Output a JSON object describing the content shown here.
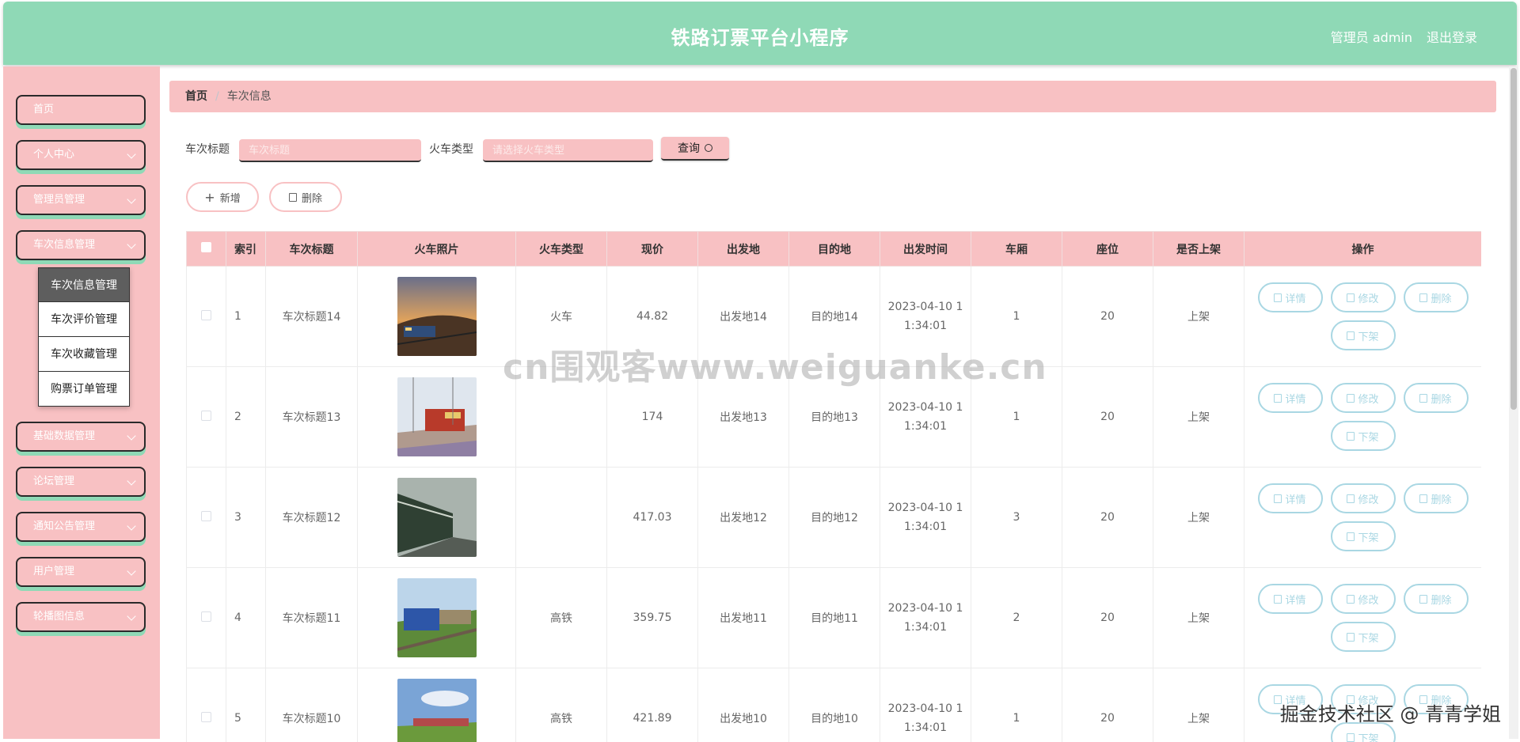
{
  "header": {
    "title": "铁路订票平台小程序",
    "user": "管理员 admin",
    "logout": "退出登录"
  },
  "sidebar": {
    "items": [
      {
        "label": "首页",
        "has_chevron": false
      },
      {
        "label": "个人中心",
        "has_chevron": true
      },
      {
        "label": "管理员管理",
        "has_chevron": true
      },
      {
        "label": "车次信息管理",
        "has_chevron": true
      },
      {
        "label": "基础数据管理",
        "has_chevron": true
      },
      {
        "label": "论坛管理",
        "has_chevron": true
      },
      {
        "label": "通知公告管理",
        "has_chevron": true
      },
      {
        "label": "用户管理",
        "has_chevron": true
      },
      {
        "label": "轮播图信息",
        "has_chevron": true
      }
    ],
    "submenu": [
      {
        "label": "车次信息管理",
        "active": true
      },
      {
        "label": "车次评价管理",
        "active": false
      },
      {
        "label": "车次收藏管理",
        "active": false
      },
      {
        "label": "购票订单管理",
        "active": false
      }
    ]
  },
  "breadcrumb": {
    "home": "首页",
    "current": "车次信息"
  },
  "filters": {
    "title_label": "车次标题",
    "title_placeholder": "车次标题",
    "type_label": "火车类型",
    "type_placeholder": "请选择火车类型",
    "query_label": "查询"
  },
  "actions": {
    "add_label": "新增",
    "delete_label": "删除"
  },
  "table": {
    "columns": [
      "",
      "索引",
      "车次标题",
      "火车照片",
      "火车类型",
      "现价",
      "出发地",
      "目的地",
      "出发时间",
      "车厢",
      "座位",
      "是否上架",
      "操作"
    ],
    "op_labels": {
      "detail": "详情",
      "edit": "修改",
      "delete": "删除",
      "offshelf": "下架"
    },
    "rows": [
      {
        "index": "1",
        "title": "车次标题14",
        "photo": "sunset-train",
        "type": "火车",
        "price": "44.82",
        "from": "出发地14",
        "to": "目的地14",
        "time": "2023-04-10 1\n1:34:01",
        "carriage": "1",
        "seats": "20",
        "listed": "上架"
      },
      {
        "index": "2",
        "title": "车次标题13",
        "photo": "red-locomotive",
        "type": "",
        "price": "174",
        "from": "出发地13",
        "to": "目的地13",
        "time": "2023-04-10 1\n1:34:01",
        "carriage": "1",
        "seats": "20",
        "listed": "上架"
      },
      {
        "index": "3",
        "title": "车次标题12",
        "photo": "green-train",
        "type": "",
        "price": "417.03",
        "from": "出发地12",
        "to": "目的地12",
        "time": "2023-04-10 1\n1:34:01",
        "carriage": "3",
        "seats": "20",
        "listed": "上架"
      },
      {
        "index": "4",
        "title": "车次标题11",
        "photo": "blue-locomotive",
        "type": "高铁",
        "price": "359.75",
        "from": "出发地11",
        "to": "目的地11",
        "time": "2023-04-10 1\n1:34:01",
        "carriage": "2",
        "seats": "20",
        "listed": "上架"
      },
      {
        "index": "5",
        "title": "车次标题10",
        "photo": "field-train",
        "type": "高铁",
        "price": "421.89",
        "from": "出发地10",
        "to": "目的地10",
        "time": "2023-04-10 1\n1:34:01",
        "carriage": "1",
        "seats": "20",
        "listed": "上架"
      }
    ]
  },
  "watermark": "cn围观客www.weiguanke.cn",
  "corner_mark": "掘金技术社区 @ 青青学姐",
  "colors": {
    "header": "#8fd9b6",
    "pink": "#f8c1c3",
    "op_blue": "#a9d7e3"
  }
}
